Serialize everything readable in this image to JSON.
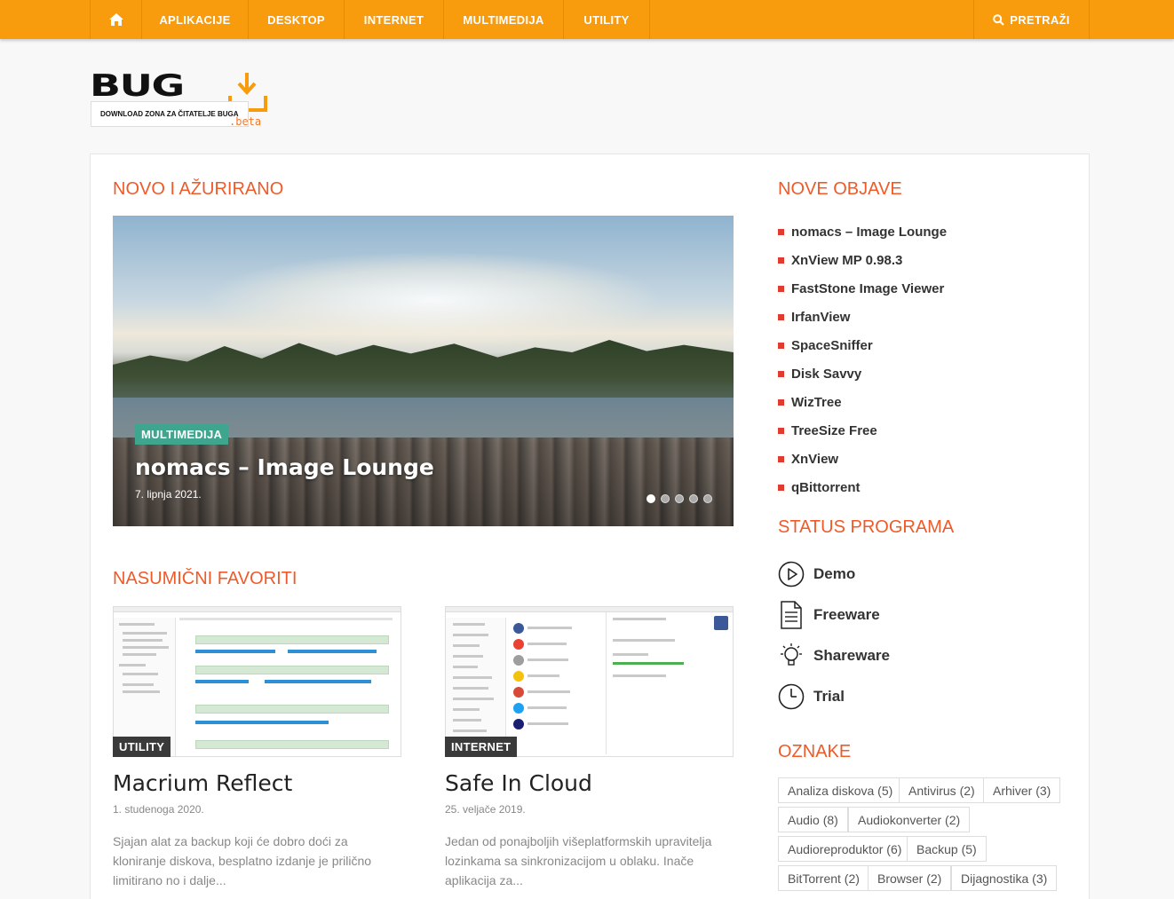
{
  "nav": {
    "home_icon": "home-icon",
    "items": [
      "APLIKACIJE",
      "DESKTOP",
      "INTERNET",
      "MULTIMEDIJA",
      "UTILITY"
    ],
    "search_label": "PRETRAŽI"
  },
  "logo": {
    "wordmark": "BUG",
    "tagline": "DOWNLOAD ZONA ZA ČITATELJE BUGA",
    "beta": ".beta"
  },
  "main": {
    "section_new": "NOVO I AŽURIRANO",
    "slide": {
      "category": "MULTIMEDIJA",
      "title": "nomacs – Image Lounge",
      "date": "7. lipnja 2021.",
      "dots": 5,
      "active_dot": 1
    },
    "section_fav": "NASUMIČNI FAVORITI",
    "favorites": [
      {
        "category": "UTILITY",
        "title": "Macrium Reflect",
        "date": "1. studenoga 2020.",
        "desc": "Sjajan alat za backup koji će dobro doći za kloniranje diskova, besplatno izdanje je prilično limitirano no i dalje..."
      },
      {
        "category": "INTERNET",
        "title": "Safe In Cloud",
        "date": "25. veljače 2019.",
        "desc": "Jedan od ponajboljih višeplatformskih upravitelja lozinkama sa sinkronizacijom u oblaku. Inače aplikacija za..."
      }
    ]
  },
  "sidebar": {
    "section_posts": "NOVE OBJAVE",
    "posts": [
      "nomacs – Image Lounge",
      "XnView MP 0.98.3",
      "FastStone Image Viewer",
      "IrfanView",
      "SpaceSniffer",
      "Disk Savvy",
      "WizTree",
      "TreeSize Free",
      "XnView",
      "qBittorrent"
    ],
    "section_status": "STATUS PROGRAMA",
    "status": [
      {
        "label": "Demo",
        "icon": "play-circle-icon"
      },
      {
        "label": "Freeware",
        "icon": "document-icon"
      },
      {
        "label": "Shareware",
        "icon": "lightbulb-icon"
      },
      {
        "label": "Trial",
        "icon": "clock-icon"
      }
    ],
    "section_tags": "OZNAKE",
    "tags": [
      "Analiza diskova (5)",
      "Antivirus (2)",
      "Arhiver (3)",
      "Audio (8)",
      "Audiokonverter (2)",
      "Audioreproduktor (6)",
      "Backup (5)",
      "BitTorrent (2)",
      "Browser (2)",
      "Dijagnostika (3)"
    ]
  },
  "colors": {
    "nav_bg": "#f89b0c",
    "accent": "#ef5a28",
    "bullet": "#e03c2d",
    "badge_green": "#3fa58e",
    "badge_dark": "#3a3a3a"
  }
}
